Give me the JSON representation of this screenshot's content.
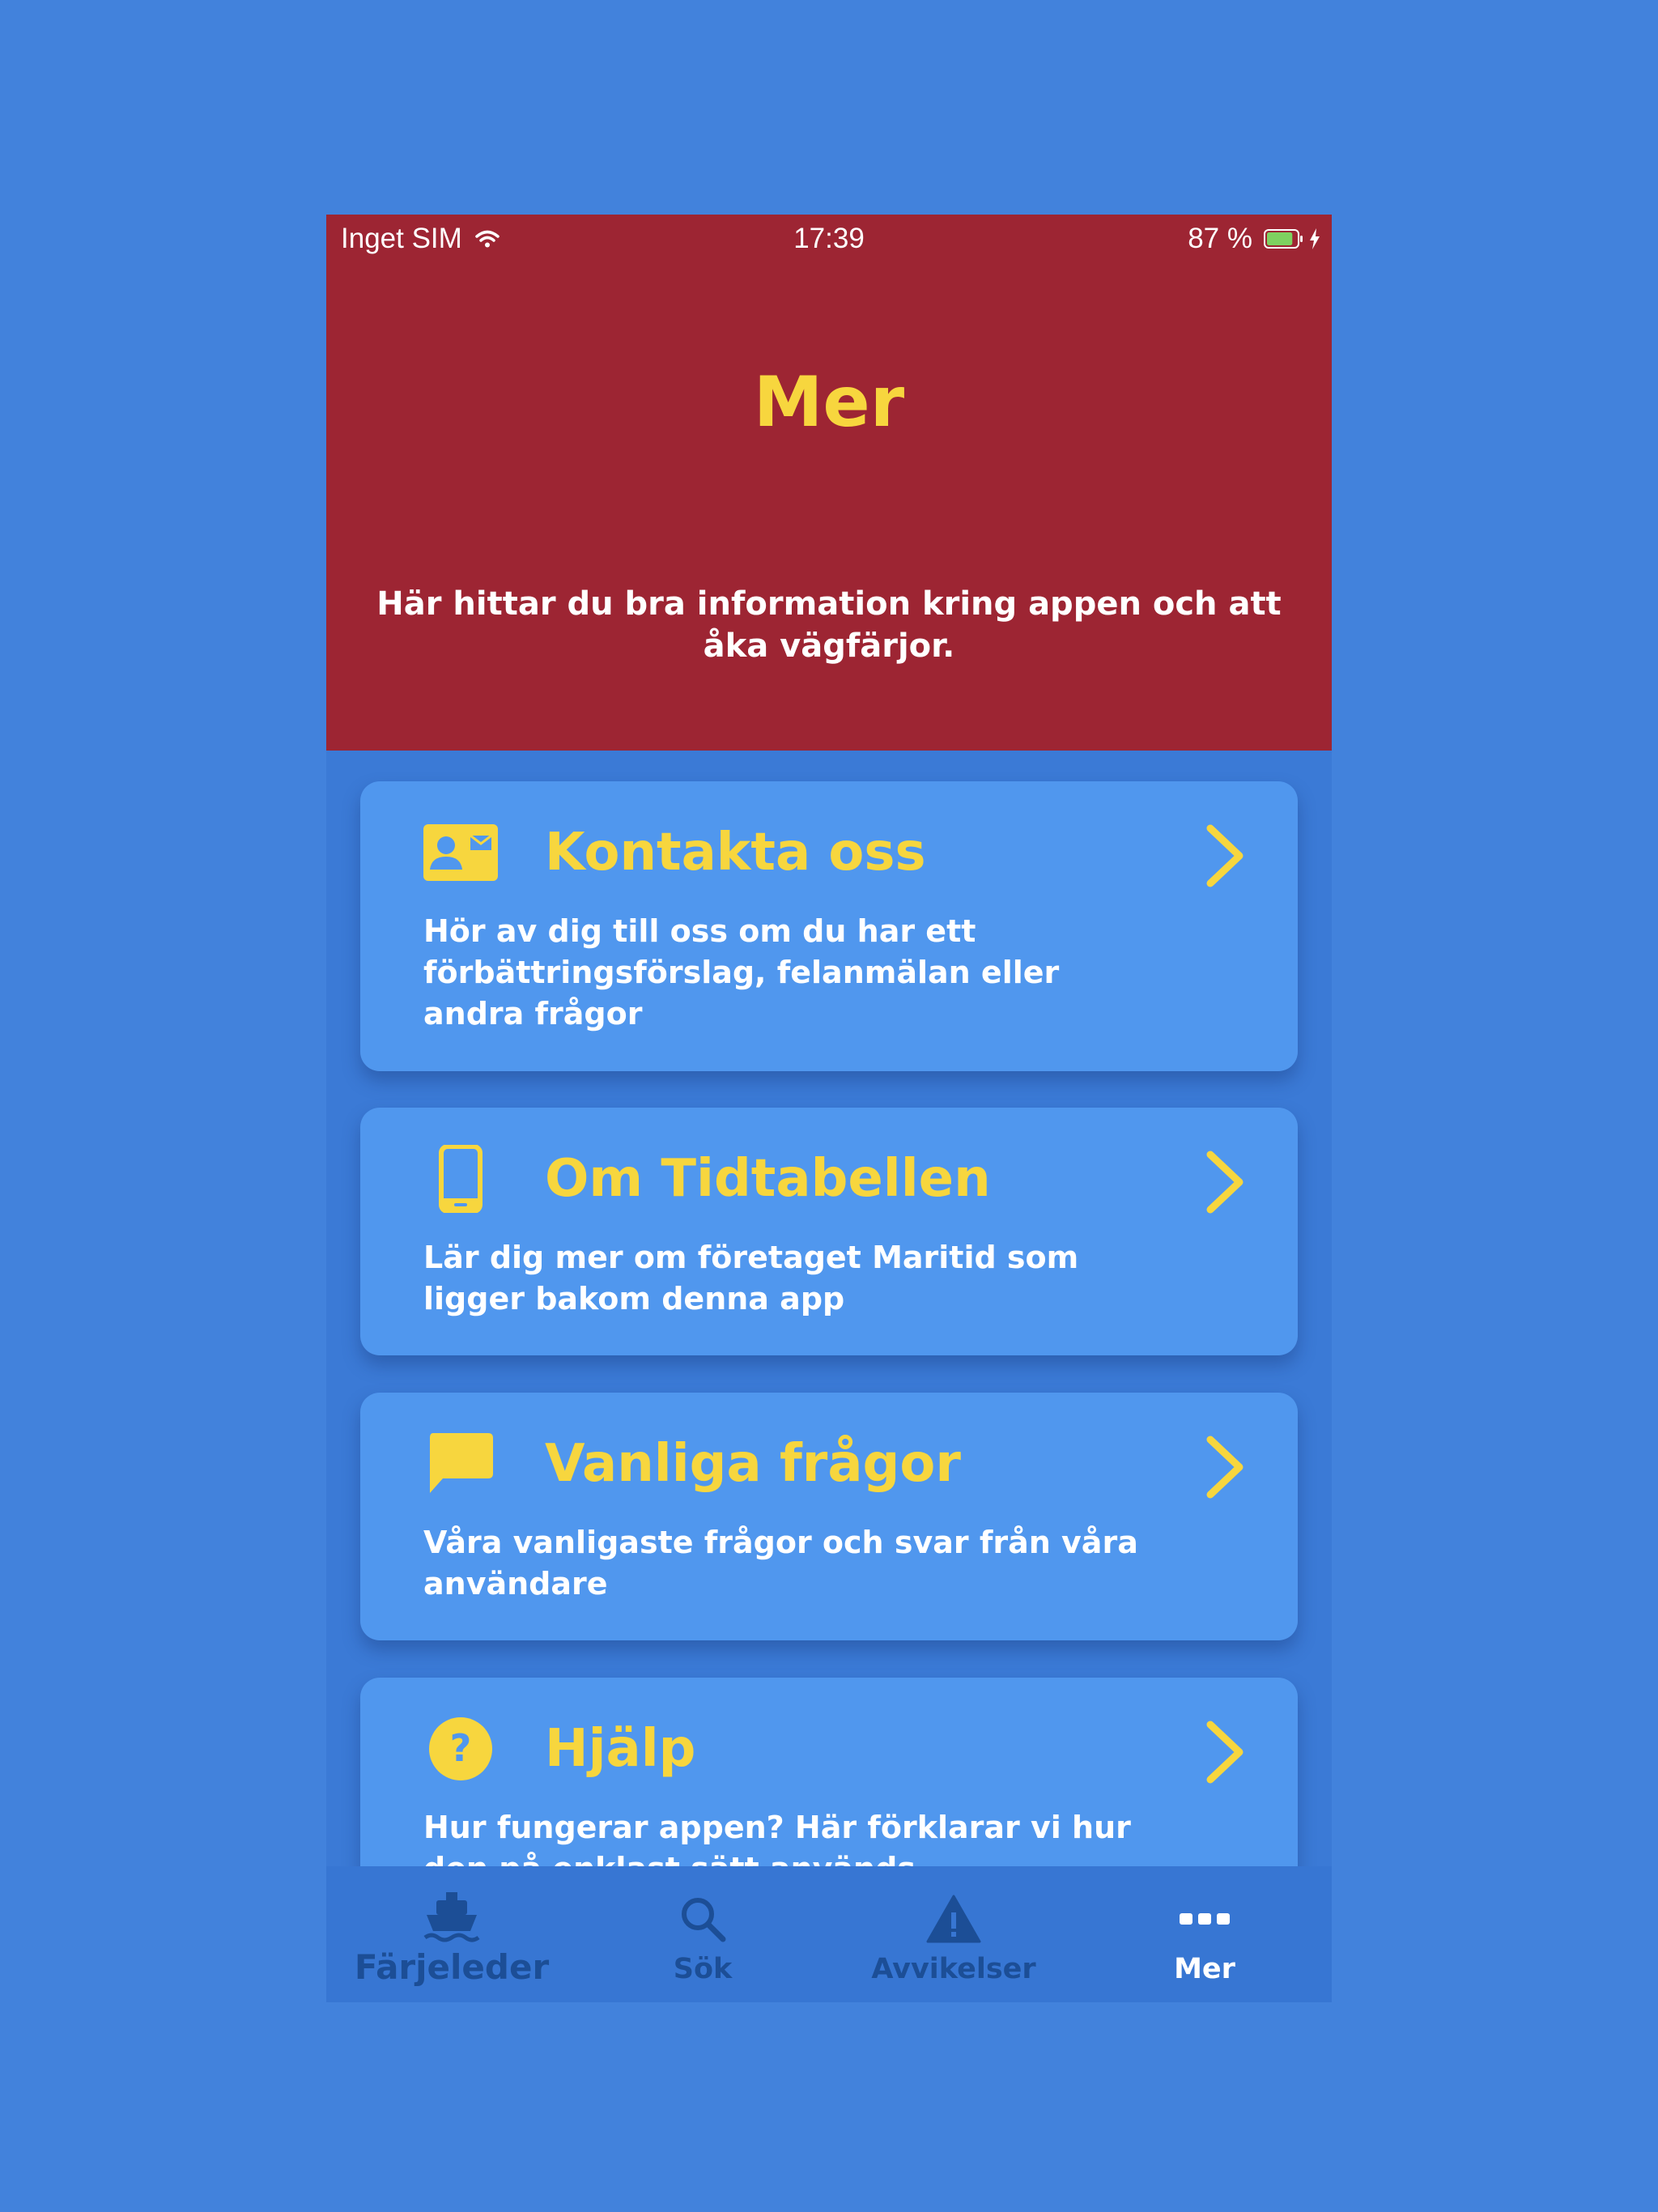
{
  "status_bar": {
    "carrier": "Inget SIM",
    "time": "17:39",
    "battery": "87 %",
    "battery_level": 0.87
  },
  "header": {
    "title": "Mer",
    "subtitle": "Här hittar du bra information kring appen och att åka vägfärjor."
  },
  "cards": [
    {
      "icon": "contact-card-icon",
      "title": "Kontakta oss",
      "text": "Hör av dig till oss om du har ett förbättringsförslag, felanmälan eller andra frågor"
    },
    {
      "icon": "phone-icon",
      "title": "Om Tidtabellen",
      "text": "Lär dig mer om företaget Maritid som ligger bakom denna app"
    },
    {
      "icon": "chat-bubble-icon",
      "title": "Vanliga frågor",
      "text": "Våra vanligaste frågor och svar från våra användare"
    },
    {
      "icon": "help-circle-icon",
      "title": "Hjälp",
      "text": "Hur fungerar appen? Här förklarar vi hur den på enklast sätt används"
    }
  ],
  "tabbar": [
    {
      "icon": "ferry-icon",
      "label": "Färjeleder",
      "active": false
    },
    {
      "icon": "search-icon",
      "label": "Sök",
      "active": false
    },
    {
      "icon": "warning-icon",
      "label": "Avvikelser",
      "active": false
    },
    {
      "icon": "more-icon",
      "label": "Mer",
      "active": true
    }
  ],
  "colors": {
    "background": "#4282dc",
    "header": "#9d2533",
    "accent": "#f7d63e",
    "card": "#5097ee",
    "tab_inactive": "#1c4e96",
    "tab_active": "#ffffff",
    "battery_fill": "#7ed160"
  }
}
